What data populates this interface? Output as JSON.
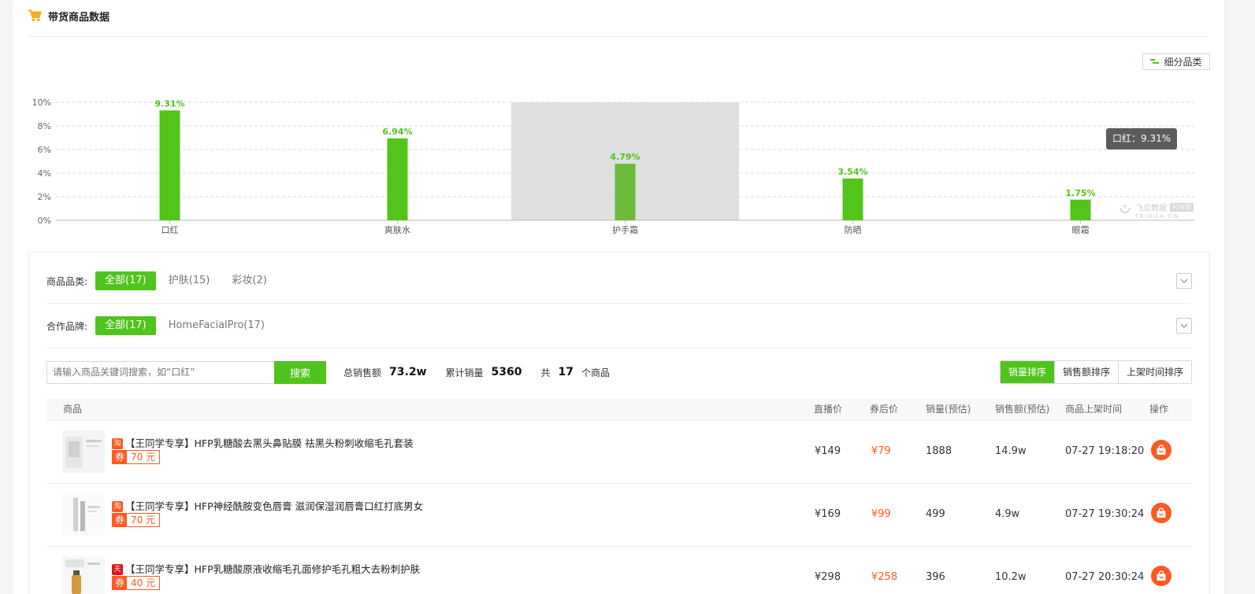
{
  "header": {
    "title": "带货商品数据",
    "subcategory_button": "细分品类"
  },
  "chart_data": {
    "type": "bar",
    "categories": [
      "口红",
      "爽肤水",
      "护手霜",
      "防晒",
      "眼霜"
    ],
    "values": [
      9.31,
      6.94,
      4.79,
      3.54,
      1.75
    ],
    "value_labels": [
      "9.31%",
      "6.94%",
      "4.79%",
      "3.54%",
      "1.75%"
    ],
    "y_ticks": [
      "0%",
      "2%",
      "4%",
      "6%",
      "8%",
      "10%"
    ],
    "ylim": [
      0,
      10
    ],
    "highlight_index": 2,
    "grid": true,
    "bar_color": "#52c41a",
    "highlight_bar_color": "#6ab93d",
    "title": "",
    "xlabel": "",
    "ylabel": ""
  },
  "tooltip": {
    "text": "口红：9.31%"
  },
  "watermark": {
    "text": "飞瓜数据",
    "badge": "抖音版",
    "sub": "FEIGUA.CN"
  },
  "filters": {
    "category": {
      "label": "商品品类:",
      "options": [
        "全部(17)",
        "护肤(15)",
        "彩妆(2)"
      ]
    },
    "brand": {
      "label": "合作品牌:",
      "options": [
        "全部(17)",
        "HomeFacialPro(17)"
      ]
    }
  },
  "search": {
    "placeholder": "请输入商品关键词搜索，如“口红”",
    "button": "搜索"
  },
  "stats": {
    "total_sales_label": "总销售额",
    "total_sales_value": "73.2w",
    "volume_label": "累计销量",
    "volume_value": "5360",
    "count_prefix": "共",
    "count_value": "17",
    "count_suffix": "个商品"
  },
  "sort": [
    "销量排序",
    "销售额排序",
    "上架时间排序"
  ],
  "table": {
    "headers": [
      "商品",
      "直播价",
      "券后价",
      "销量(预估)",
      "销售额(预估)",
      "商品上架时间",
      "操作"
    ],
    "rows": [
      {
        "platform": "淘",
        "title": "【王同学专享】HFP乳糖酸去黑头鼻贴膜 祛黑头粉刺收缩毛孔套装",
        "coupon_tag": "券",
        "coupon_value": "70 元",
        "live_price": "¥149",
        "after_price": "¥79",
        "volume": "1888",
        "sales": "14.9w",
        "listed": "07-27 19:18:20"
      },
      {
        "platform": "淘",
        "title": "【王同学专享】HFP神经酰胺变色唇膏 滋润保湿润唇膏口红打底男女",
        "coupon_tag": "券",
        "coupon_value": "70 元",
        "live_price": "¥169",
        "after_price": "¥99",
        "volume": "499",
        "sales": "4.9w",
        "listed": "07-27 19:30:24"
      },
      {
        "platform": "天猫",
        "title": "【王同学专享】HFP乳糖酸原液收缩毛孔面修护毛孔粗大去粉刺护肤",
        "coupon_tag": "券",
        "coupon_value": "40 元",
        "live_price": "¥298",
        "after_price": "¥258",
        "volume": "396",
        "sales": "10.2w",
        "listed": "07-27 20:30:24"
      }
    ]
  }
}
